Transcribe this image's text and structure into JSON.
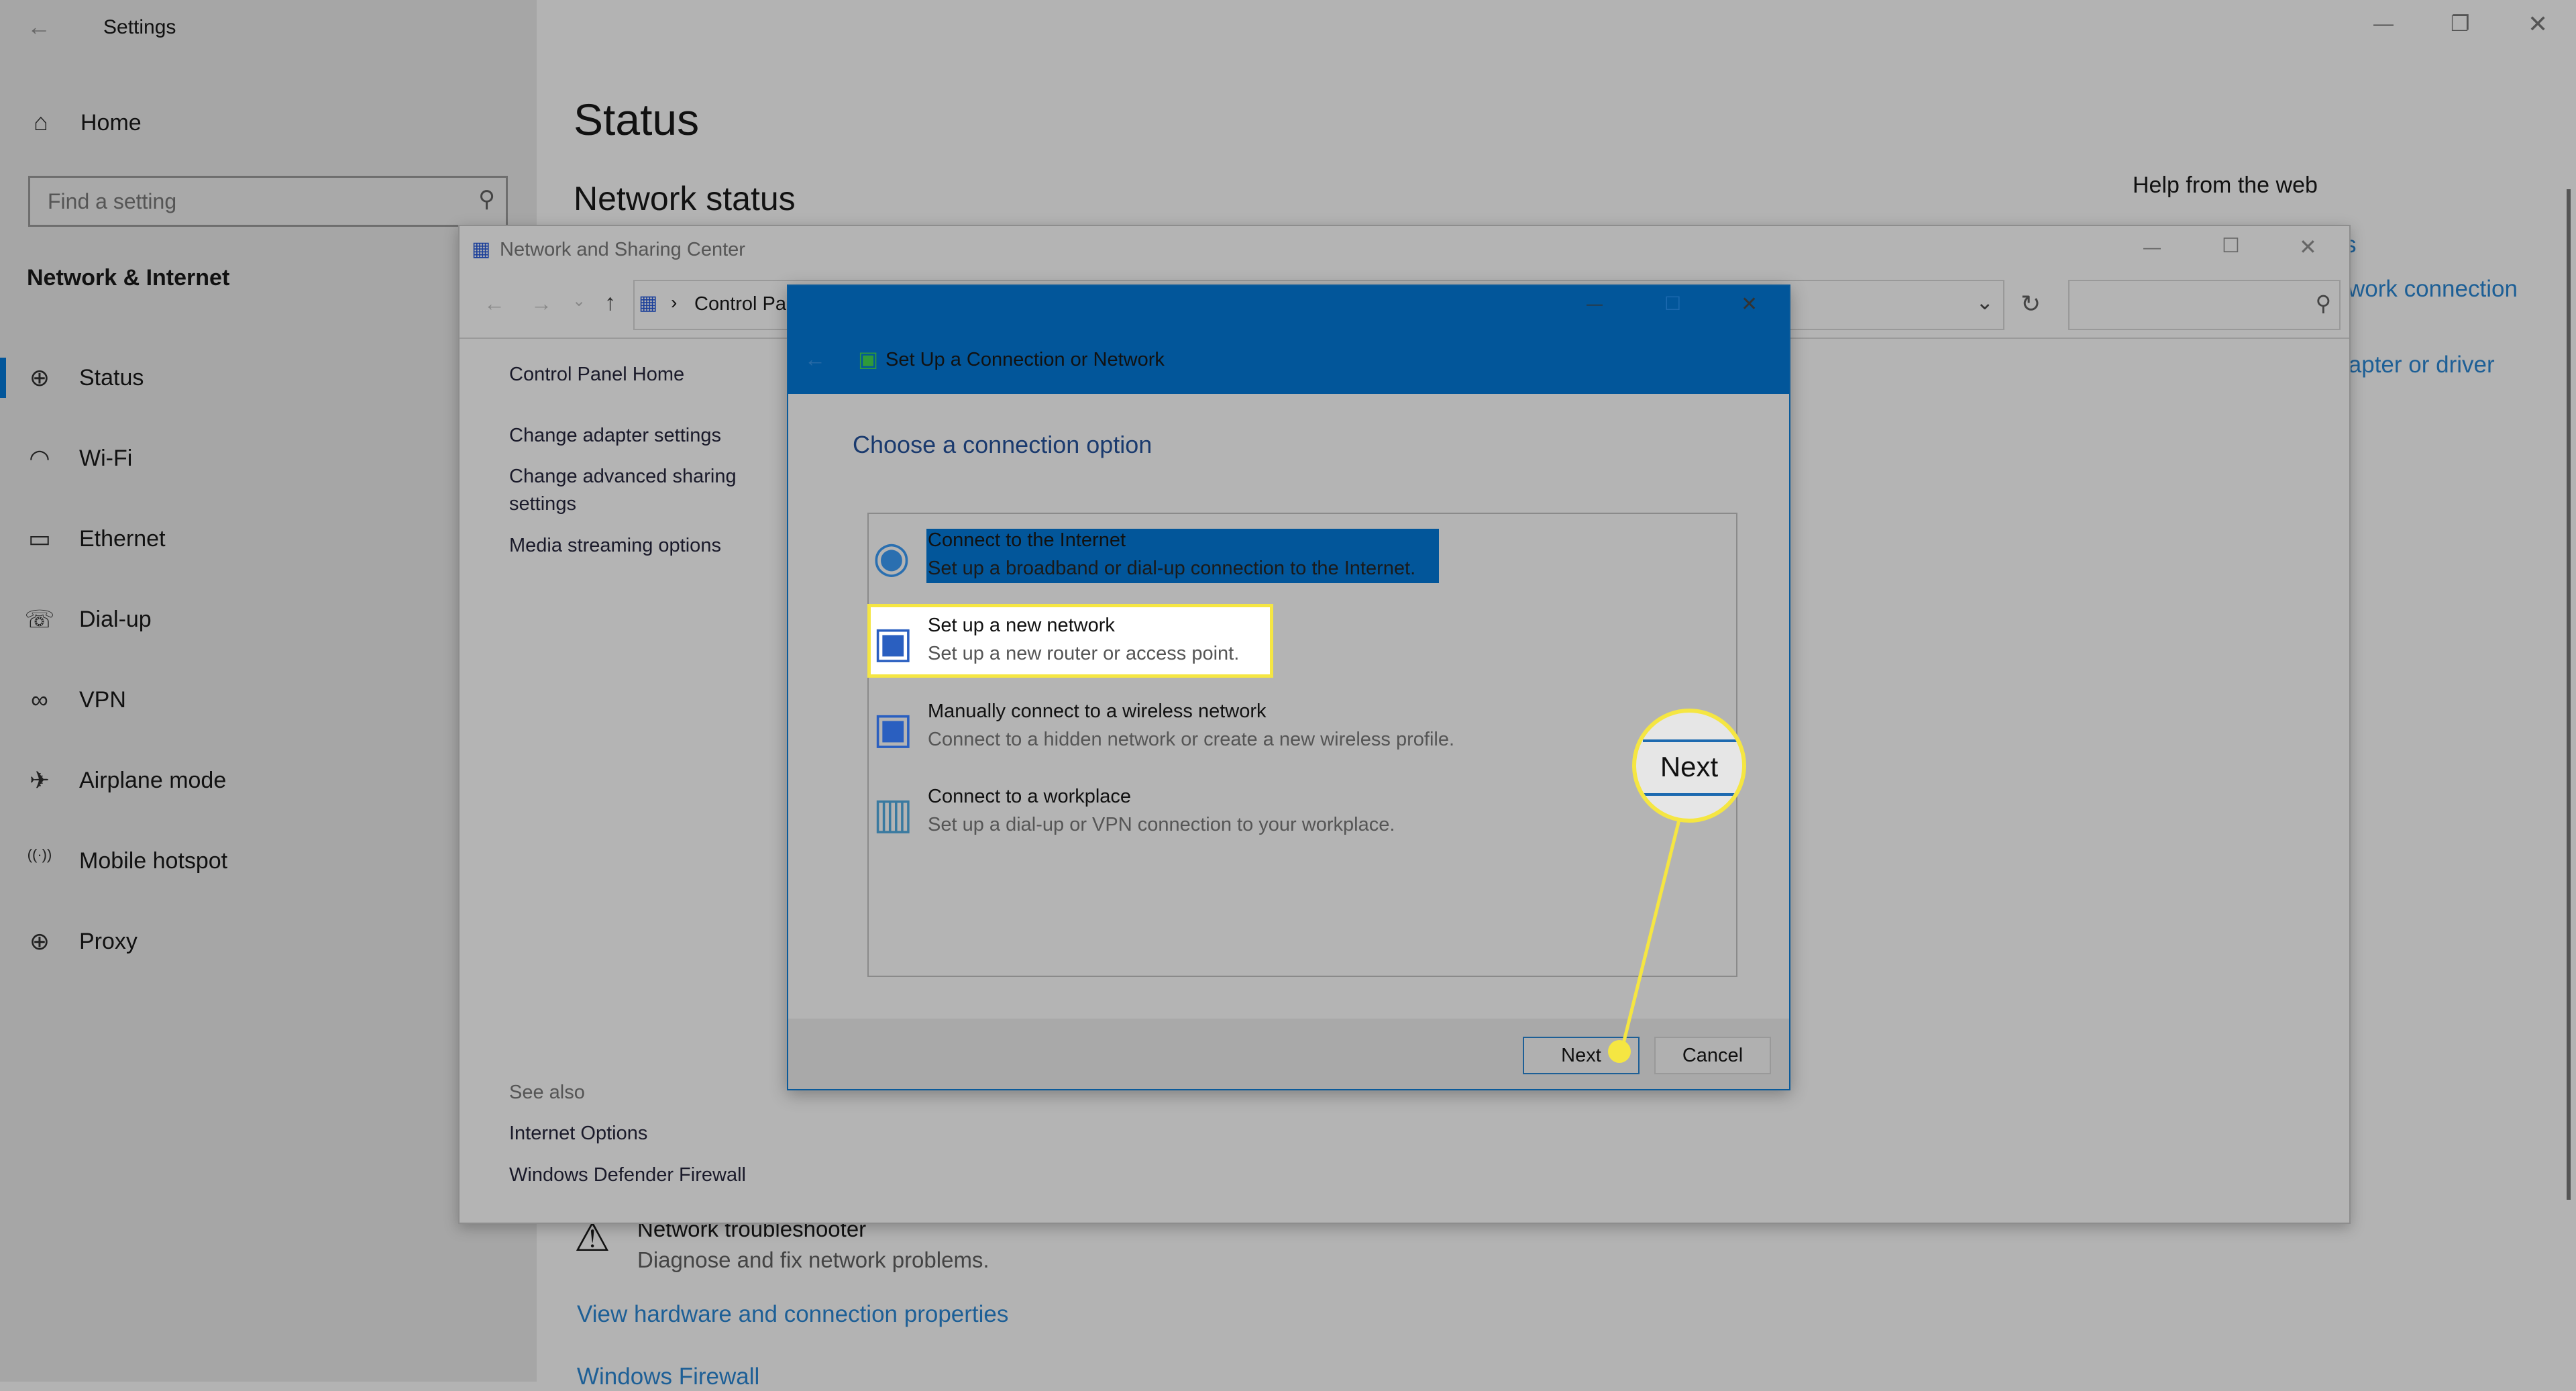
{
  "settings": {
    "title": "Settings",
    "home": "Home",
    "search_placeholder": "Find a setting",
    "section": "Network & Internet",
    "nav": [
      {
        "label": "Status",
        "icon": "globe-monitor-icon",
        "active": true
      },
      {
        "label": "Wi-Fi",
        "icon": "wifi-icon"
      },
      {
        "label": "Ethernet",
        "icon": "ethernet-icon"
      },
      {
        "label": "Dial-up",
        "icon": "dialup-icon"
      },
      {
        "label": "VPN",
        "icon": "vpn-icon"
      },
      {
        "label": "Airplane mode",
        "icon": "airplane-icon"
      },
      {
        "label": "Mobile hotspot",
        "icon": "hotspot-icon"
      },
      {
        "label": "Proxy",
        "icon": "globe-icon"
      }
    ],
    "page_title": "Status",
    "network_status": "Network status",
    "help_title": "Help from the web",
    "help_links": [
      "s",
      "work connection",
      "lapter or driver"
    ],
    "troubleshooter_title": "Network troubleshooter",
    "troubleshooter_desc": "Diagnose and fix network problems.",
    "view_hardware": "View hardware and connection properties",
    "windows_firewall": "Windows Firewall"
  },
  "nsc": {
    "title": "Network and Sharing Center",
    "breadcrumb": "Control Pa",
    "links": [
      "Control Panel Home",
      "Change adapter settings",
      "Change advanced sharing",
      "settings",
      "Media streaming options"
    ],
    "see_also": "See also",
    "see_also_links": [
      "Internet Options",
      "Windows Defender Firewall"
    ]
  },
  "dialog": {
    "title": "Set Up a Connection or Network",
    "heading": "Choose a connection option",
    "options": [
      {
        "title": "Connect to the Internet",
        "desc": "Set up a broadband or dial-up connection to the Internet.",
        "selected": true
      },
      {
        "title": "Set up a new network",
        "desc": "Set up a new router or access point.",
        "highlighted": true
      },
      {
        "title": "Manually connect to a wireless network",
        "desc": "Connect to a hidden network or create a new wireless profile."
      },
      {
        "title": "Connect to a workplace",
        "desc": "Set up a dial-up or VPN connection to your workplace."
      }
    ],
    "next": "Next",
    "cancel": "Cancel"
  },
  "callout": {
    "label": "Next",
    "color": "#f5e642"
  },
  "colors": {
    "accent": "#02569a",
    "link": "#1d5f96",
    "highlight": "#f5e642"
  }
}
